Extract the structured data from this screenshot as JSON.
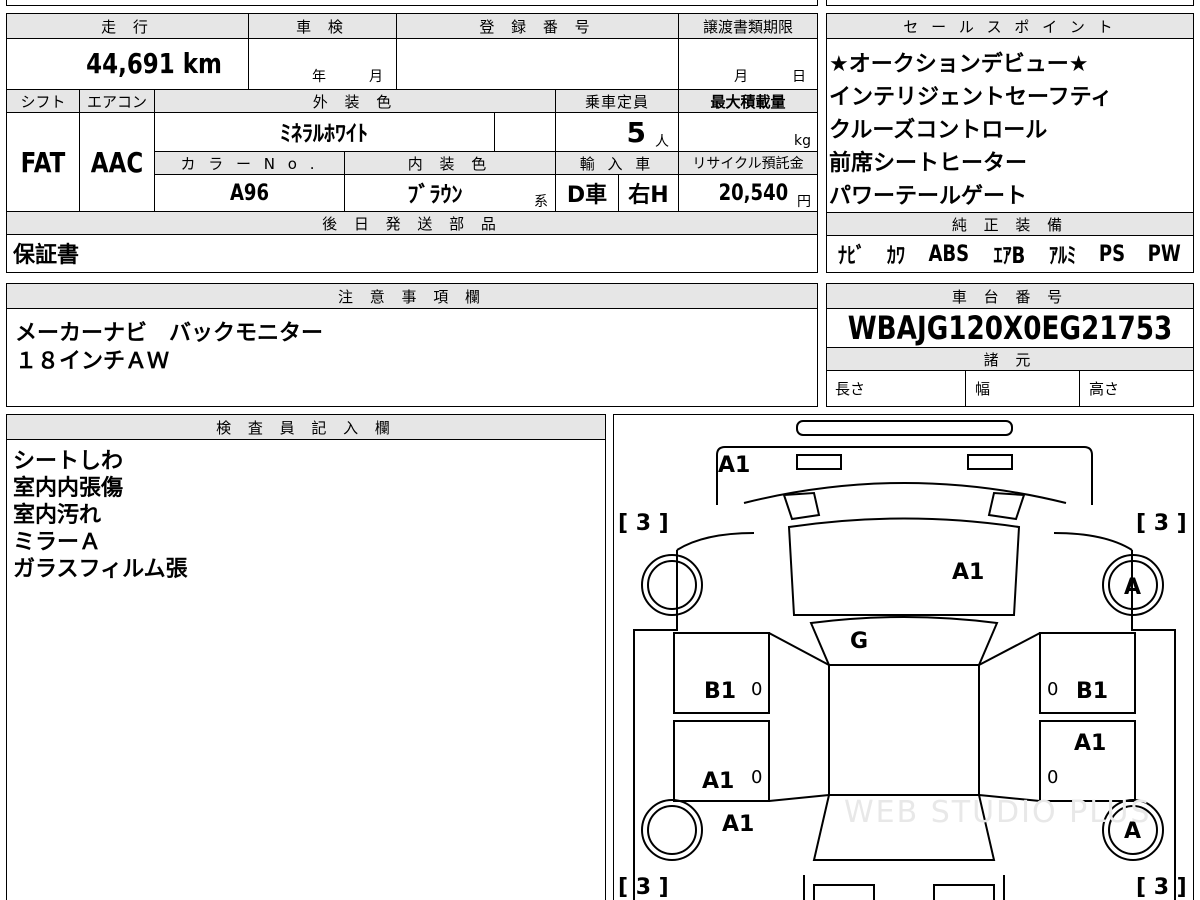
{
  "labels": {
    "mileage": "走 行",
    "inspection": "車 検",
    "registration": "登 録 番 号",
    "doc_deadline": "譲渡書類期限",
    "shift": "シフト",
    "aircon": "エアコン",
    "exterior_color": "外 装 色",
    "capacity": "乗車定員",
    "max_load": "最大積載量",
    "color_no": "カ ラ ー N o .",
    "interior_color": "内 装 色",
    "import": "輸 入 車",
    "recycle_fee": "リサイクル預託金",
    "later_parts": "後 日 発 送 部 品",
    "sales_points": "セ ー ル ス ポ イ ン ト",
    "genuine_equipment": "純 正 装 備",
    "notes": "注 意 事 項 欄",
    "chassis_no": "車 台 番 号",
    "specs": "諸 元",
    "inspector_notes": "検 査 員 記 入 欄",
    "length": "長さ",
    "width": "幅",
    "height": "高さ",
    "year_unit": "年",
    "month_unit": "月",
    "month_unit2": "月",
    "day_unit": "日",
    "person_unit": "人",
    "kg_unit": "kg",
    "yen_unit": "円",
    "kei_unit": "系"
  },
  "values": {
    "mileage": "44,691 km",
    "shift": "FAT",
    "aircon": "AAC",
    "exterior_color": "ﾐﾈﾗﾙﾎﾜｲﾄ",
    "capacity": "5",
    "color_no": "A96",
    "interior_color": "ﾌﾞﾗｳﾝ",
    "import_side": "D車",
    "steering": "右H",
    "recycle_fee": "20,540",
    "later_parts": "保証書",
    "chassis_no": "WBAJG120X0EG21753"
  },
  "sales_points": [
    "★オークションデビュー★",
    "インテリジェントセーフティ",
    "クルーズコントロール",
    "前席シートヒーター",
    "パワーテールゲート"
  ],
  "equipment": [
    "ﾅﾋﾞ",
    "ｶﾜ",
    "ABS",
    "ｴｱB",
    "ｱﾙﾐ",
    "PS",
    "PW"
  ],
  "notes": [
    "メーカーナビ　バックモニター",
    "１８インチＡＷ"
  ],
  "inspector_notes": [
    "シートしわ",
    "室内内張傷",
    "室内汚れ",
    "ミラーＡ",
    "ガラスフィルム張"
  ],
  "diagram": {
    "bracket_tl": "[ 3 ]",
    "bracket_tr": "[ 3 ]",
    "bracket_bl": "[ 3 ]",
    "bracket_br": "[ 3 ]",
    "front_bumper": "A1",
    "hood": "A1",
    "windshield": "G",
    "wheel_fr": "A",
    "wheel_rr": "A",
    "door_fl": "B1",
    "door_fl_zero": "0",
    "door_fr": "B1",
    "door_fr_zero": "0",
    "door_rl": "A1",
    "door_rl_zero": "0",
    "door_rr": "A1",
    "door_rr_zero": "0",
    "quarter_l": "A1",
    "watermark": "WEB STUDIO PLUS"
  }
}
